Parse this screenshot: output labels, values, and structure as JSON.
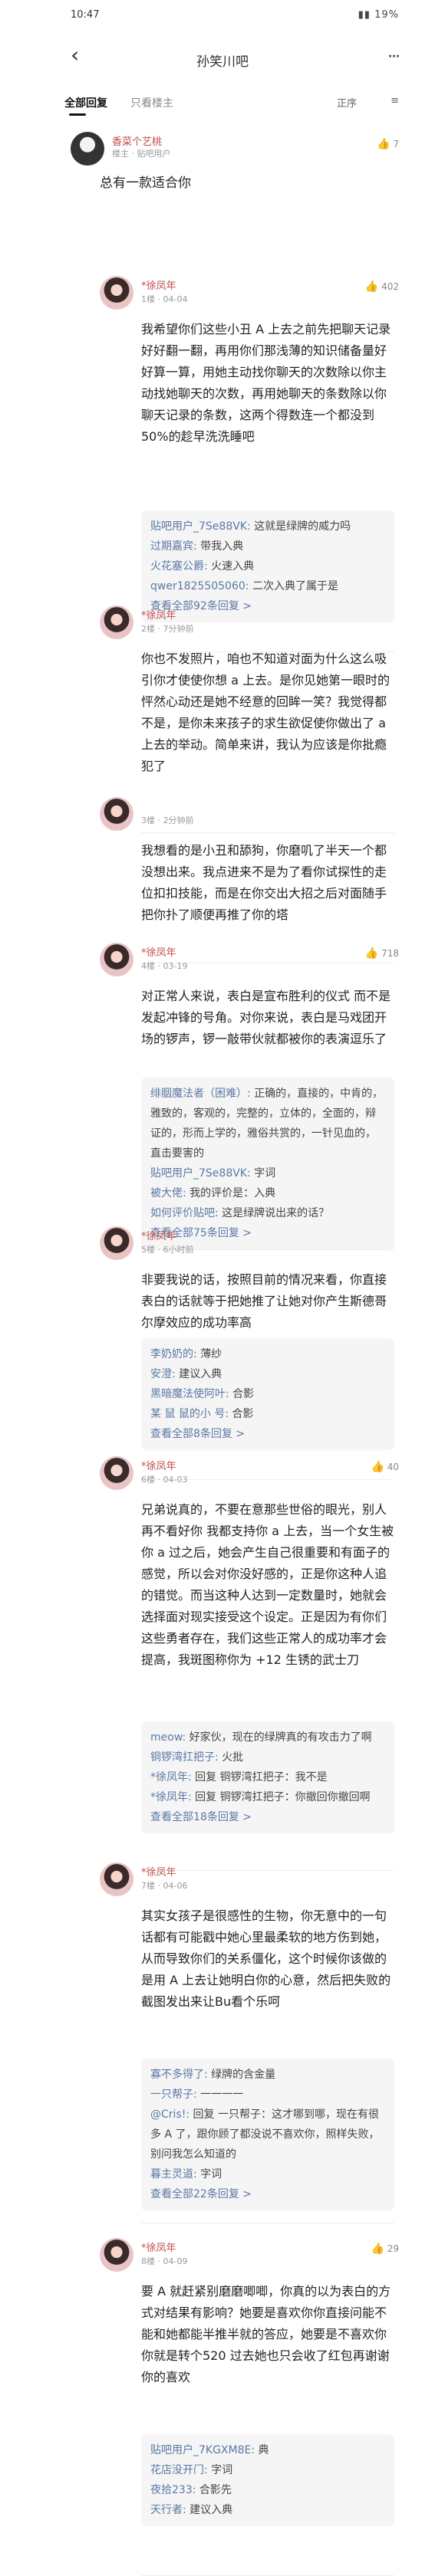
{
  "status": {
    "time": "10:47",
    "battery": "19%"
  },
  "nav": {
    "title": "孙笑川吧",
    "back": "‹",
    "more": "···"
  },
  "tabs": {
    "all": "全部回复",
    "lz": "只看楼主",
    "sort1": "正序",
    "sort2": "≡"
  },
  "op": {
    "name": "香菜个艺桃",
    "meta": "楼主 · 贴吧用户",
    "text": "总有一款适合你",
    "like_count": "7"
  },
  "floors": [
    {
      "name": "*徐凤年",
      "meta": "1楼 · 04-04",
      "likes": "402",
      "text": "我希望你们这些小丑 A 上去之前先把聊天记录好好翻一翻，再用你们那浅薄的知识储备量好好算一算，用她主动找你聊天的次数除以你主动找她聊天的次数，再用她聊天的条数除以你聊天记录的条数，这两个得数连一个都没到50%的趁早洗洗睡吧",
      "replies": [
        {
          "name": "贴吧用户_7Se88VK:",
          "text": "这就是绿牌的威力吗"
        },
        {
          "name": "过期嘉宾:",
          "text": "带我入典"
        },
        {
          "name": "火花塞公爵:",
          "text": "火速入典"
        },
        {
          "name": "qwer1825505060:",
          "text": "二次入典了属于是"
        }
      ],
      "more": "查看全部92条回复"
    },
    {
      "name": "*徐凤年",
      "meta": "2楼 · 7分钟前",
      "likes": "",
      "text": "你也不发照片，咱也不知道对面为什么这么吸引你才使使你想 a 上去。是你见她第一眼时的怦然心动还是她不经意的回眸一笑？我觉得都不是，是你未来孩子的求生欲促使你做出了 a 上去的举动。简单来讲，我认为应该是你批瘾犯了",
      "replies": [],
      "more": ""
    },
    {
      "name": "",
      "meta": "3楼 · 2分钟前",
      "likes": "",
      "text": "我想看的是小丑和舔狗，你磨叽了半天一个都没想出来。我点进来不是为了看你试探性的走位扣扣技能，而是在你交出大招之后对面随手把你扑了顺便再推了你的塔",
      "replies": [],
      "more": ""
    },
    {
      "name": "*徐凤年",
      "meta": "4楼 · 03-19",
      "likes": "718",
      "text": "对正常人来说，表白是宣布胜利的仪式 而不是发起冲锋的号角。对你来说，表白是马戏团开场的锣声，锣一敲带伙就都被你的表演逗乐了",
      "replies": [
        {
          "name": "绯胭魔法者（困难）:",
          "text": "正确的，直接的，中肯的，雅致的，客观的，完整的，立体的，全面的，辩证的，形而上学的，雅俗共赏的，一针见血的，直击要害的"
        },
        {
          "name": "贴吧用户_7Se88VK:",
          "text": "字词"
        },
        {
          "name": "被大佬:",
          "text": "我的评价是：入典"
        },
        {
          "name": "如何评价贴吧:",
          "text": "这是绿牌说出来的话？"
        }
      ],
      "more": "查看全部75条回复"
    },
    {
      "name": "*徐凤年",
      "meta": "5楼 · 6小时前",
      "likes": "",
      "text": "非要我说的话，按照目前的情况来看，你直接表白的话就等于把她推了让她对你产生斯德哥尔摩效应的成功率高",
      "replies": [
        {
          "name": "李奶奶的:",
          "text": "薄纱"
        },
        {
          "name": "安澄:",
          "text": "建议入典"
        },
        {
          "name": "黑暗魔法使阿叶:",
          "text": "合影"
        },
        {
          "name": "某 鼠 鼠的小 号:",
          "text": "合影"
        }
      ],
      "more": "查看全部8条回复"
    },
    {
      "name": "*徐凤年",
      "meta": "6楼 · 04-03",
      "likes": "40",
      "text": "兄弟说真的，不要在意那些世俗的眼光，别人再不看好你 我都支持你 a 上去，当一个女生被你 a 过之后，她会产生自己很重要和有面子的感觉，所以会对你没好感的，正是你这种人追的错觉。而当这种人达到一定数量时，她就会选择面对现实接受这个设定。正是因为有你们这些勇者存在，我们这些正常人的成功率才会提高，我斑图称你为 +12 生锈的武士刀",
      "replies": [
        {
          "name": "meow:",
          "text": "好家伙，现在的绿牌真的有攻击力了啊"
        },
        {
          "name": "铜锣湾扛把子:",
          "text": "火批"
        },
        {
          "name": "*徐凤年:",
          "text": "回复 铜锣湾扛把子：我不是"
        },
        {
          "name": "*徐凤年:",
          "text": "回复 铜锣湾扛把子：你撤回你撤回啊"
        }
      ],
      "more": "查看全部18条回复"
    },
    {
      "name": "*徐凤年",
      "meta": "7楼 · 04-06",
      "likes": "",
      "text": "其实女孩子是很感性的生物，你无意中的一句话都有可能戳中她心里最柔软的地方伤到她，从而导致你们的关系僵化，这个时候你该做的是用 A 上去让她明白你的心意，然后把失败的截图发出来让Bu看个乐呵",
      "replies": [
        {
          "name": "寡不多得了:",
          "text": "绿牌的含金量"
        },
        {
          "name": "一只帮子:",
          "text": "一一一一"
        },
        {
          "name": "@Cris!:",
          "text": "回复 一只帮子：这才哪到哪，现在有很多 A 了，跟你顾了都没说不喜欢你，照样失败，别问我怎么知道的"
        },
        {
          "name": "暮主灵道:",
          "text": "字词"
        }
      ],
      "more": "查看全部22条回复"
    },
    {
      "name": "*徐凤年",
      "meta": "8楼 · 04-09",
      "likes": "29",
      "text": "要 A 就赶紧别磨磨唧唧，你真的以为表白的方式对结果有影响？她要是喜欢你你直接问能不能和她都能半推半就的答应，她要是不喜欢你你就是转个520 过去她也只会收了红包再谢谢你的喜欢",
      "replies": [
        {
          "name": "贴吧用户_7KGXM8E:",
          "text": "典"
        },
        {
          "name": "花店没开门:",
          "text": "字词"
        },
        {
          "name": "夜拾233:",
          "text": "合影先"
        },
        {
          "name": "天行者:",
          "text": "建议入典"
        }
      ],
      "more": ""
    }
  ]
}
